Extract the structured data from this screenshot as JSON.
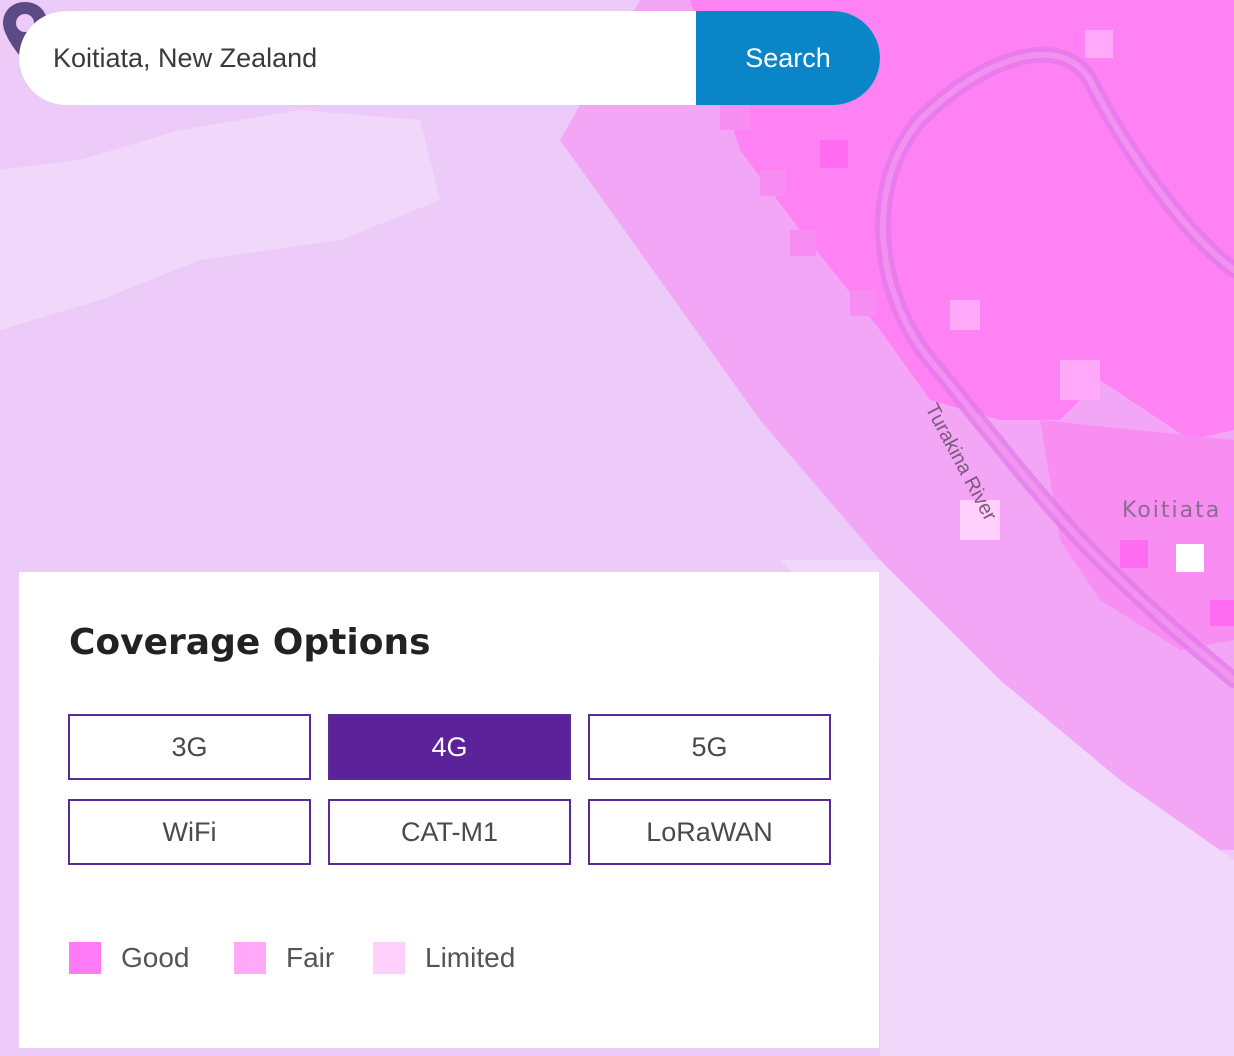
{
  "search": {
    "value": "Koitiata, New Zealand",
    "button_label": "Search",
    "button_color": "#0a86c8"
  },
  "map": {
    "river_label": "Turakina River",
    "place_label": "Koitiata",
    "pin_icon": "map-pin-icon",
    "pin_color": "#5b4a86"
  },
  "panel": {
    "title": "Coverage Options",
    "options": [
      {
        "label": "3G",
        "selected": false
      },
      {
        "label": "4G",
        "selected": true
      },
      {
        "label": "5G",
        "selected": false
      },
      {
        "label": "WiFi",
        "selected": false
      },
      {
        "label": "CAT-M1",
        "selected": false
      },
      {
        "label": "LoRaWAN",
        "selected": false
      }
    ],
    "selected_color": "#5c2299"
  },
  "legend": [
    {
      "label": "Good",
      "color": "#ff7af4"
    },
    {
      "label": "Fair",
      "color": "#ffa9f8"
    },
    {
      "label": "Limited",
      "color": "#ffd0fb"
    }
  ]
}
